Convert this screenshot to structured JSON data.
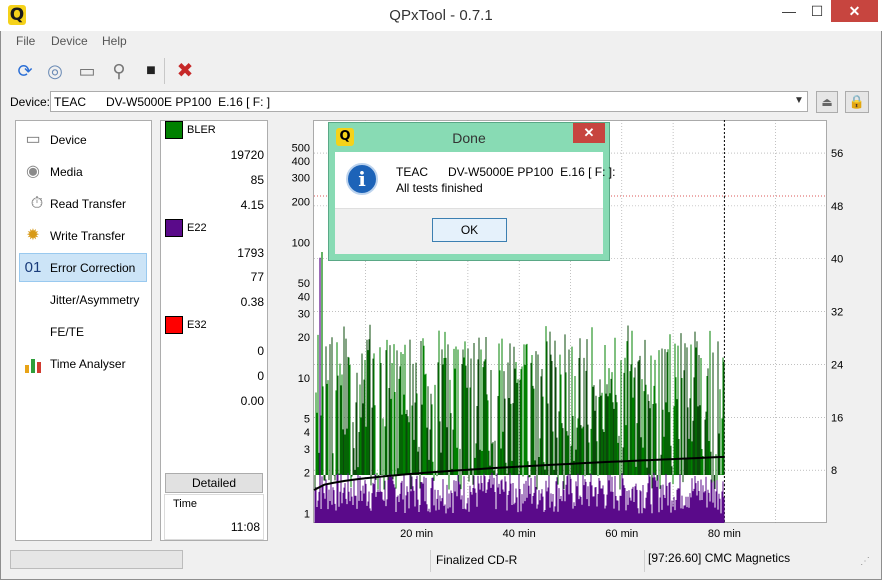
{
  "window": {
    "title": "QPxTool - 0.7.1",
    "app_icon_letter": "Q",
    "min_glyph": "—",
    "max_glyph": "☐",
    "close_glyph": "✕"
  },
  "menu": {
    "file": "File",
    "device": "Device",
    "help": "Help"
  },
  "toolbar": {
    "refresh_icon": "refresh-icon",
    "media_icon": "disc-icon",
    "device_icon": "drive-icon",
    "info_icon": "magnifier-icon",
    "stop_icon": "stop-icon",
    "tools_icon": "tools-icon"
  },
  "device": {
    "label": "Device:",
    "selected": "TEAC      DV-W5000E PP100  E.16 [ F: ]",
    "arrow": "▼"
  },
  "sidebar": {
    "items": [
      {
        "label": "Device",
        "icon": "drive-icon"
      },
      {
        "label": "Media",
        "icon": "disc-icon"
      },
      {
        "label": "Read Transfer",
        "icon": "read-transfer-icon"
      },
      {
        "label": "Write Transfer",
        "icon": "write-transfer-icon"
      },
      {
        "label": "Error Correction",
        "icon": "error-correction-icon",
        "prefix": "01",
        "active": true
      },
      {
        "label": "Jitter/Asymmetry",
        "icon": ""
      },
      {
        "label": "FE/TE",
        "icon": ""
      },
      {
        "label": "Time Analyser",
        "icon": "bars-chart-icon"
      }
    ]
  },
  "results": {
    "bler": {
      "name": "BLER",
      "color": "#008000",
      "total": "19720",
      "max": "85",
      "avg": "4.15"
    },
    "e22": {
      "name": "E22",
      "color": "#5a0a8a",
      "total": "1793",
      "max": "77",
      "avg": "0.38"
    },
    "e32": {
      "name": "E32",
      "color": "#ff0000",
      "total": "0",
      "max": "0",
      "avg": "0.00"
    },
    "detailed_button": "Detailed",
    "time_label": "Time",
    "time_value": "11:08"
  },
  "chart_data": {
    "type": "area",
    "log_scale_y": true,
    "yticks_left": [
      "500",
      "400",
      "300",
      "200",
      "100",
      "50",
      "40",
      "30",
      "20",
      "10",
      "5",
      "4",
      "3",
      "2",
      "1"
    ],
    "yticks_left_values": [
      500,
      400,
      300,
      200,
      100,
      50,
      40,
      30,
      20,
      10,
      5,
      4,
      3,
      2,
      1
    ],
    "ylim_left": [
      0.85,
      800
    ],
    "yticks_right": [
      "56",
      "48",
      "40",
      "32",
      "24",
      "16",
      "8"
    ],
    "yticks_right_values": [
      56,
      48,
      40,
      32,
      24,
      16,
      8
    ],
    "ylim_right": [
      0,
      61
    ],
    "xticks": [
      "20 min",
      "40 min",
      "60 min",
      "80 min"
    ],
    "xticks_values": [
      20,
      40,
      60,
      80
    ],
    "xlim": [
      0,
      100
    ],
    "disc_end_min": 80,
    "grid": true,
    "series": [
      {
        "name": "BLER",
        "color": "#008000",
        "peak": 85,
        "typical_max": 20
      },
      {
        "name": "E22",
        "color": "#5a0a8a",
        "peak": 77,
        "typical_max": 2
      },
      {
        "name": "E32",
        "color": "#ff0000",
        "peak": 0
      }
    ],
    "speed_curve": {
      "color": "#000000",
      "start": 5,
      "end": 10
    }
  },
  "dialog": {
    "title": "Done",
    "icon_letter": "Q",
    "line1": "TEAC      DV-W5000E PP100  E.16 [ F: ]:",
    "line2": "All tests finished",
    "ok": "OK",
    "close_glyph": "✕",
    "info_glyph": "i"
  },
  "status": {
    "disc_type": "Finalized CD-R",
    "media_info": "[97:26.60] CMC Magnetics"
  }
}
